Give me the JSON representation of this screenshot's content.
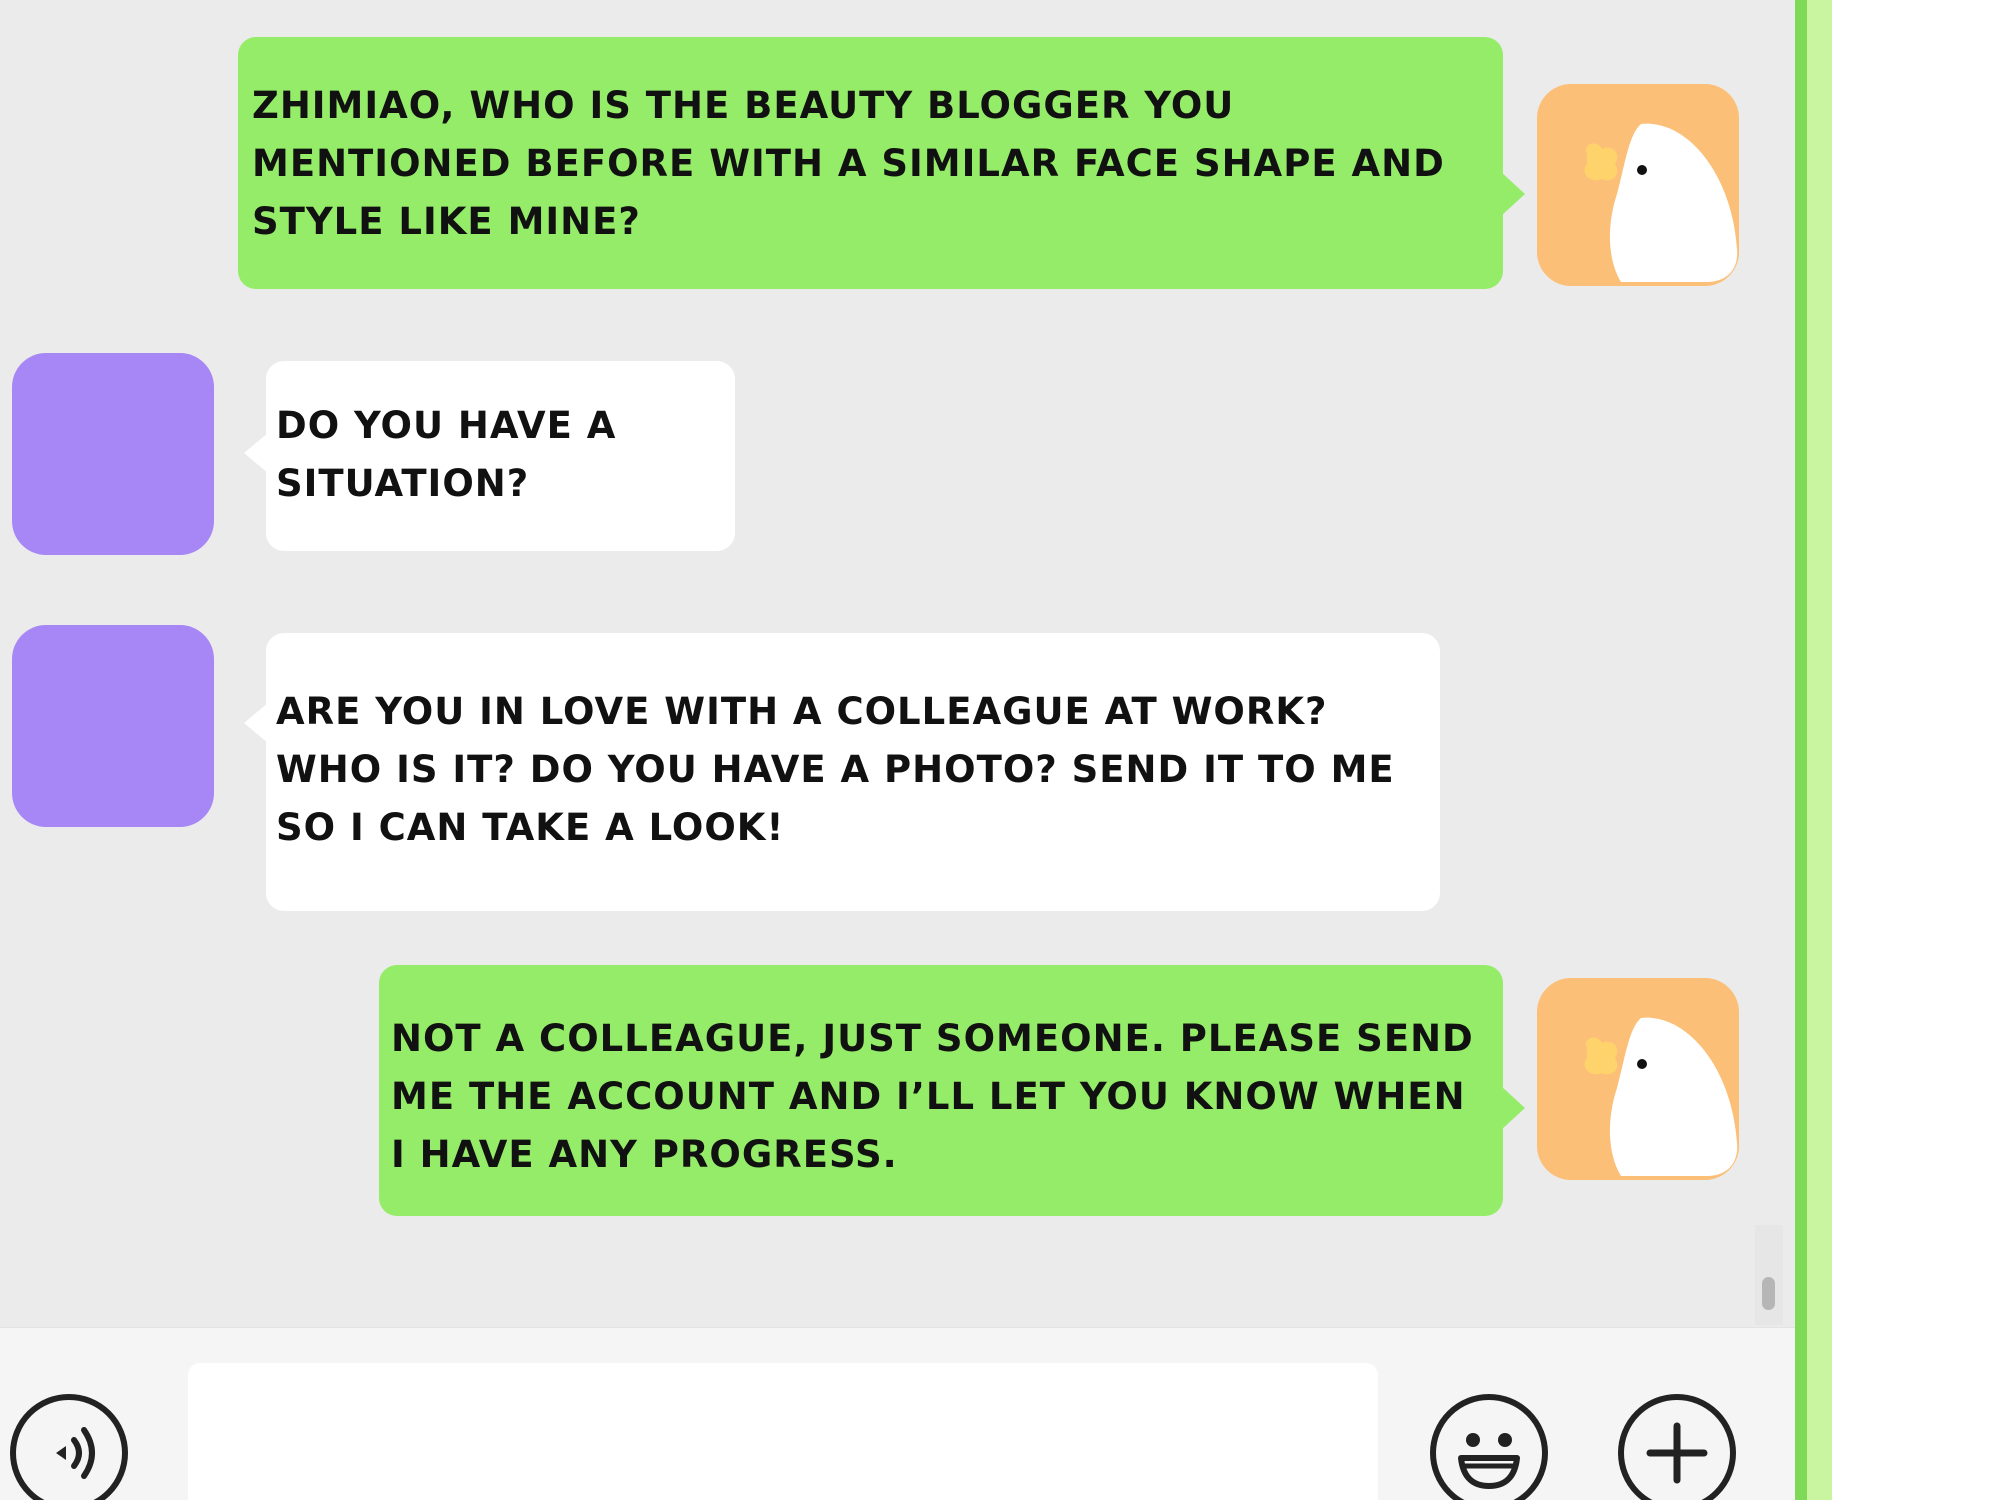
{
  "messages": [
    {
      "sender": "me",
      "text": "ZHIMIAO, WHO IS THE BEAUTY BLOGGER YOU MENTIONED BEFORE WITH A SIMILAR FACE SHAPE AND STYLE LIKE MINE?"
    },
    {
      "sender": "other",
      "text": "DO YOU HAVE A SITUATION?"
    },
    {
      "sender": "other",
      "text": "ARE YOU IN LOVE WITH A COLLEAGUE AT WORK? WHO IS IT? DO YOU HAVE A PHOTO? SEND IT TO ME SO I CAN TAKE A LOOK!"
    },
    {
      "sender": "me",
      "text": "NOT A COLLEAGUE, JUST SOMEONE. PLEASE SEND ME THE ACCOUNT AND I’LL LET YOU KNOW WHEN I HAVE ANY PROGRESS."
    }
  ],
  "input": {
    "value": "",
    "placeholder": ""
  },
  "icons": {
    "voice": "voice-icon",
    "emoji": "emoji-icon",
    "plus": "plus-icon",
    "my_avatar": "chick-avatar-icon"
  },
  "colors": {
    "sent_bubble": "#95ec69",
    "received_bubble": "#ffffff",
    "chat_background": "#ebebeb",
    "other_avatar": "#a687f5",
    "my_avatar": "#fbbf77"
  }
}
